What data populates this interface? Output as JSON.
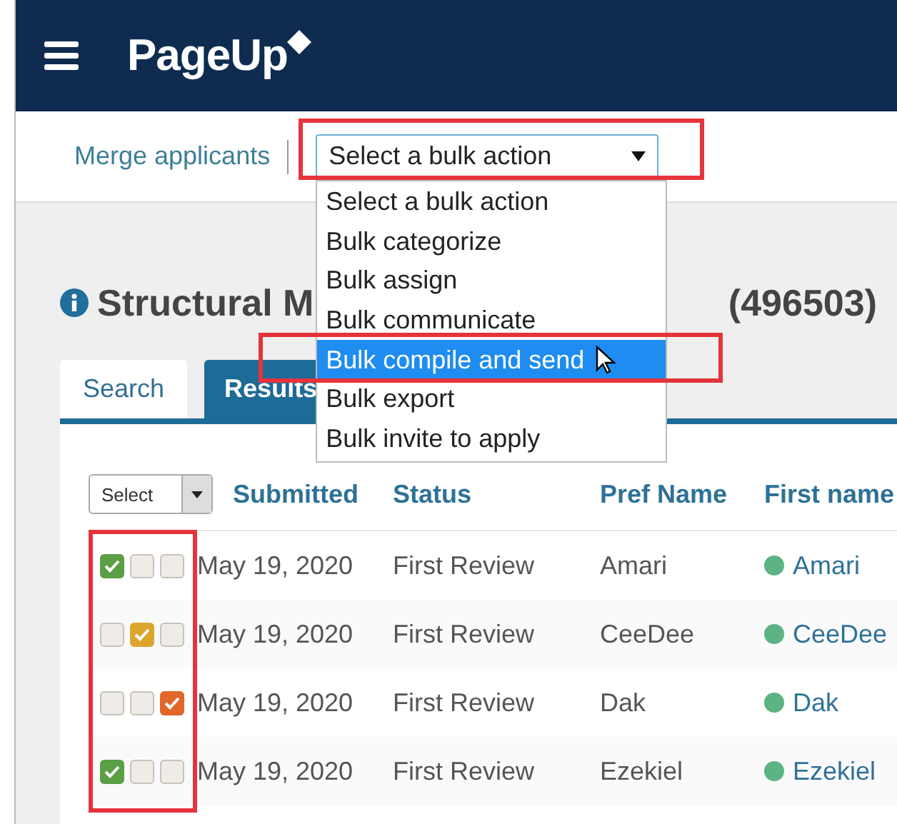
{
  "header": {
    "logo": "PageUp"
  },
  "toolbar": {
    "merge_link": "Merge applicants",
    "bulk_select": {
      "value": "Select a bulk action",
      "highlighted": true,
      "expanded": true
    }
  },
  "bulk_options": [
    {
      "label": "Select a bulk action",
      "selected": false,
      "highlighted": false
    },
    {
      "label": "Bulk categorize",
      "selected": false,
      "highlighted": false
    },
    {
      "label": "Bulk assign",
      "selected": false,
      "highlighted": false
    },
    {
      "label": "Bulk communicate",
      "selected": false,
      "highlighted": false
    },
    {
      "label": "Bulk compile and send",
      "selected": true,
      "highlighted": true
    },
    {
      "label": "Bulk export",
      "selected": false,
      "highlighted": false
    },
    {
      "label": "Bulk invite to apply",
      "selected": false,
      "highlighted": false
    }
  ],
  "title": {
    "start": "Structural M",
    "end": "(496503)"
  },
  "tabs": [
    {
      "label": "Search",
      "selected": false
    },
    {
      "label": "Results",
      "selected": true
    }
  ],
  "table": {
    "select_control": "Select",
    "flags_highlighted": true,
    "flag_types": [
      {
        "color": "#5a9e45"
      },
      {
        "color": "#dca52c"
      },
      {
        "color": "#e0662a"
      }
    ],
    "columns": [
      "Submitted",
      "Status",
      "Pref Name",
      "First name"
    ],
    "rows": [
      {
        "flags": [
          {
            "checked": true
          },
          {
            "checked": false
          },
          {
            "checked": false
          }
        ],
        "submitted": "May 19, 2020",
        "status": "First Review",
        "pref_name": "Amari",
        "first_name": "Amari",
        "color": "#5cb383"
      },
      {
        "flags": [
          {
            "checked": false
          },
          {
            "checked": true
          },
          {
            "checked": false
          }
        ],
        "submitted": "May 19, 2020",
        "status": "First Review",
        "pref_name": "CeeDee",
        "first_name": "CeeDee",
        "color": "#5cb383"
      },
      {
        "flags": [
          {
            "checked": false
          },
          {
            "checked": false
          },
          {
            "checked": true
          }
        ],
        "submitted": "May 19, 2020",
        "status": "First Review",
        "pref_name": "Dak",
        "first_name": "Dak",
        "color": "#5cb383"
      },
      {
        "flags": [
          {
            "checked": true
          },
          {
            "checked": false
          },
          {
            "checked": false
          }
        ],
        "submitted": "May 19, 2020",
        "status": "First Review",
        "pref_name": "Ezekiel",
        "first_name": "Ezekiel",
        "color": "#5cb383"
      }
    ]
  }
}
